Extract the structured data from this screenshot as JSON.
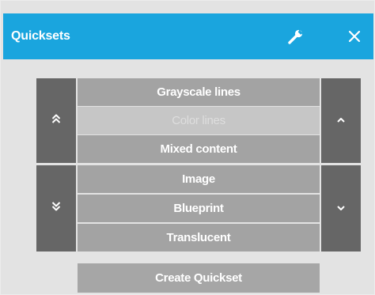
{
  "window": {
    "title": "Quicksets"
  },
  "list": {
    "items": [
      {
        "label": "Grayscale lines",
        "state": "normal"
      },
      {
        "label": "Color lines",
        "state": "disabled"
      },
      {
        "label": "Mixed content",
        "state": "normal"
      },
      {
        "label": "Image",
        "state": "normal"
      },
      {
        "label": "Blueprint",
        "state": "normal"
      },
      {
        "label": "Translucent",
        "state": "normal"
      }
    ]
  },
  "actions": {
    "create_label": "Create Quickset"
  },
  "icons": {
    "settings": "wrench-icon",
    "close": "close-icon",
    "page_up": "double-chevron-up-icon",
    "page_down": "double-chevron-down-icon",
    "scroll_up": "chevron-up-icon",
    "scroll_down": "chevron-down-icon"
  },
  "colors": {
    "titlebar": "#1aa5de",
    "panel_bg": "#e3e3e3",
    "list_item": "#a3a3a3",
    "list_item_disabled": "#c6c6c6",
    "side_button": "#666666"
  }
}
